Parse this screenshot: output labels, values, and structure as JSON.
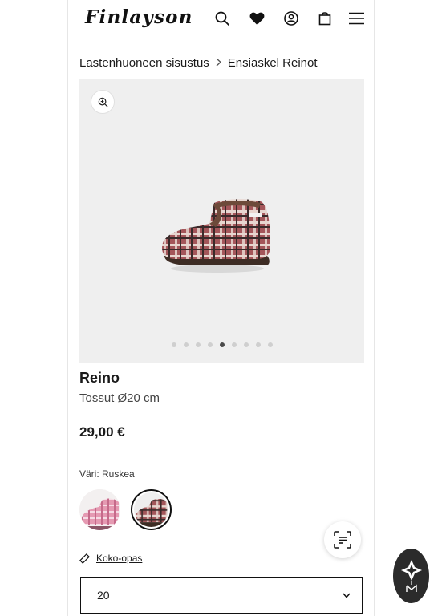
{
  "header": {
    "logo": "Finlayson",
    "icons": [
      "search-icon",
      "heart-icon",
      "account-icon",
      "bag-icon",
      "menu-icon"
    ]
  },
  "breadcrumb": {
    "items": [
      "Lastenhuoneen sisustus",
      "Ensiaskel Reinot"
    ]
  },
  "gallery": {
    "dot_count": 9,
    "active_index": 4
  },
  "product": {
    "name": "Reino",
    "subtitle": "Tossut Ø20 cm",
    "price": "29,00 €"
  },
  "color": {
    "label": "Väri: Ruskea",
    "swatches": [
      "pink",
      "brown"
    ],
    "selected": "brown"
  },
  "size": {
    "guide_label": "Koko-opas",
    "selected_value": "20"
  },
  "colors": {
    "text": "#1a1a1a",
    "gallery_bg": "#efefef",
    "dark_badge": "#2b2b2b"
  }
}
